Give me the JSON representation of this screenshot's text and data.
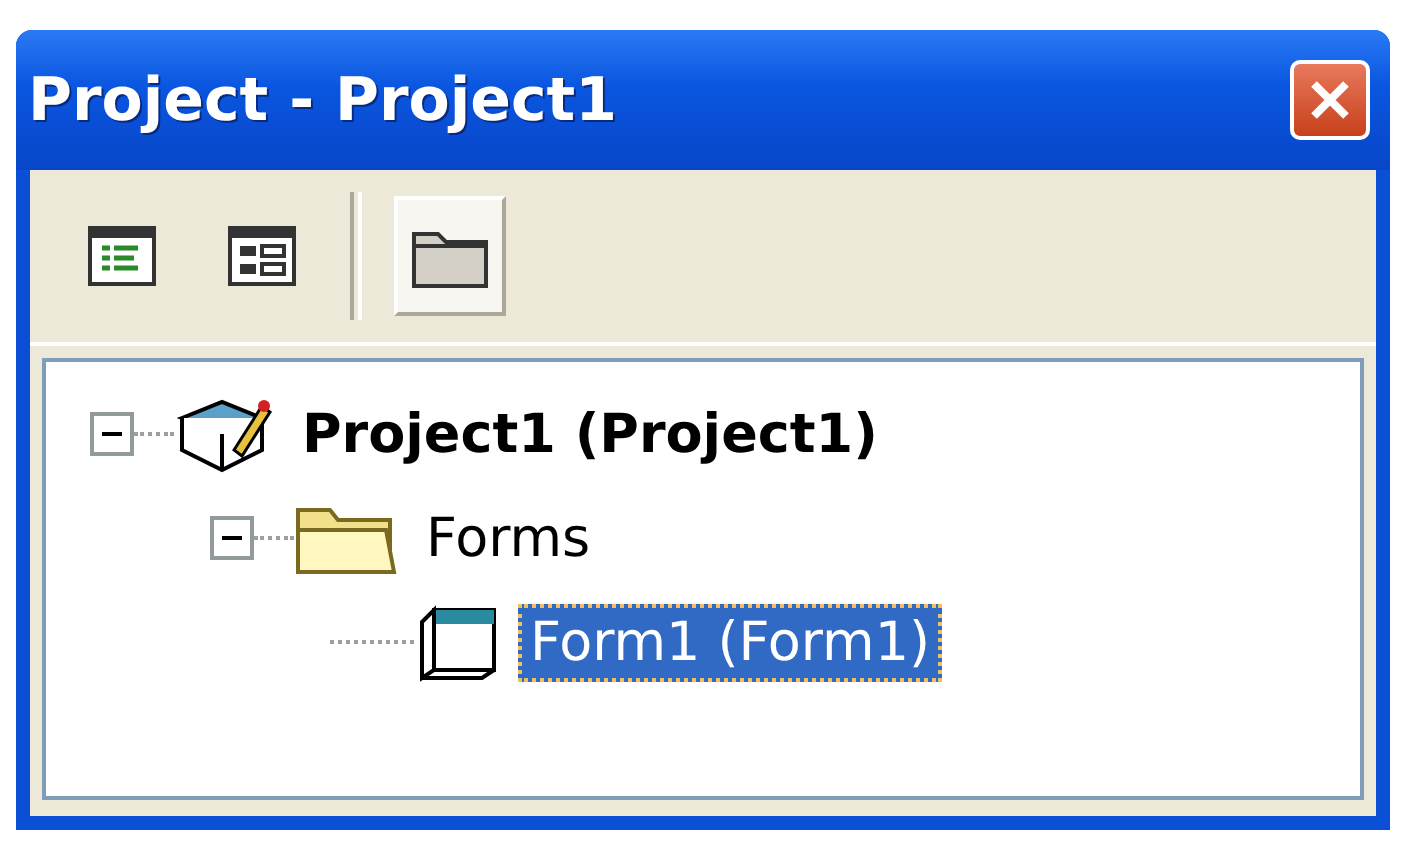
{
  "window": {
    "title": "Project - Project1"
  },
  "toolbar": [
    {
      "kind": "view-code",
      "selected": false
    },
    {
      "kind": "view-object",
      "selected": false
    },
    {
      "kind": "toggle-folders",
      "selected": true
    }
  ],
  "tree": [
    {
      "label": "Project1 (Project1)",
      "kind": "project",
      "selected": false,
      "expanded": true,
      "children": [
        {
          "label": "Forms",
          "kind": "folder",
          "selected": false,
          "expanded": true,
          "children": [
            {
              "label": "Form1 (Form1)",
              "kind": "form",
              "selected": true
            }
          ]
        }
      ]
    }
  ]
}
